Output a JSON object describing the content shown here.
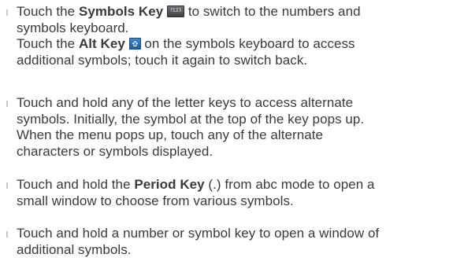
{
  "items": [
    {
      "lines": [
        [
          "Touch the ",
          {
            "b": "Symbols Key"
          },
          " ",
          {
            "icon": "symbols-key-icon"
          },
          " to switch to the numbers and"
        ],
        [
          "symbols keyboard."
        ],
        [
          "Touch the ",
          {
            "b": "Alt Key"
          },
          " ",
          {
            "icon": "alt-key-icon"
          },
          " on the symbols keyboard to access"
        ],
        [
          "additional symbols; touch it again to switch back."
        ]
      ]
    },
    {
      "lines": [
        [
          "Touch and hold any of the letter keys to access alternate"
        ],
        [
          "symbols. Initially, the symbol at the top of the key pops up."
        ],
        [
          "When the menu pops up, touch any of the alternate"
        ],
        [
          "characters or symbols displayed."
        ]
      ]
    },
    {
      "lines": [
        [
          "Touch and hold the ",
          {
            "b": "Period Key"
          },
          " (.) from abc mode to open a"
        ],
        [
          "small window to choose from various symbols."
        ]
      ]
    },
    {
      "lines": [
        [
          "Touch and hold a number or symbol key to open a window of"
        ],
        [
          "additional symbols."
        ]
      ]
    }
  ],
  "symbols_key_icon_text": "?123"
}
